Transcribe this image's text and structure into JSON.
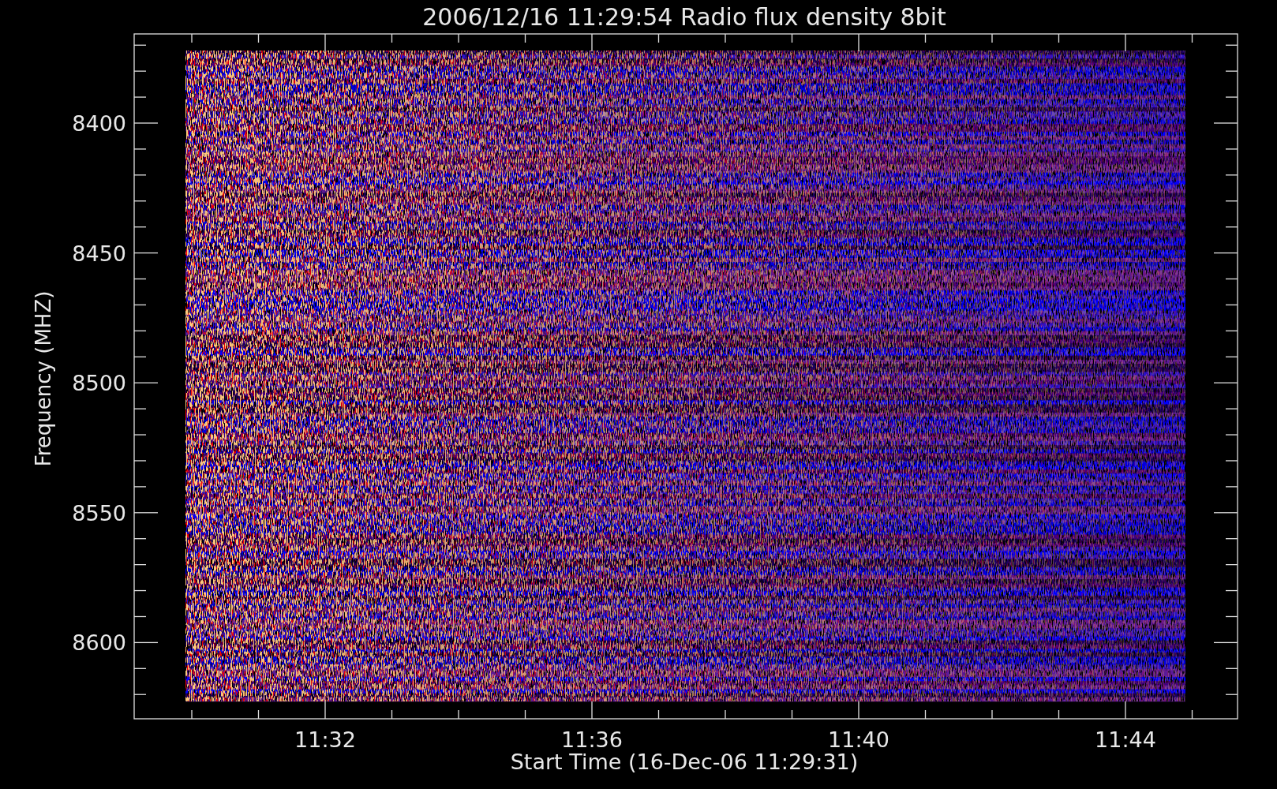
{
  "title": "2006/12/16 11:29:54 Radio flux density 8bit",
  "y_axis": {
    "title": "Frequency (MHZ)",
    "ticks": [
      "8400",
      "8450",
      "8500",
      "8550",
      "8600"
    ]
  },
  "x_axis": {
    "title": "Start Time (16-Dec-06 11:29:31)",
    "ticks": [
      "11:32",
      "11:36",
      "11:40",
      "11:44"
    ]
  }
}
